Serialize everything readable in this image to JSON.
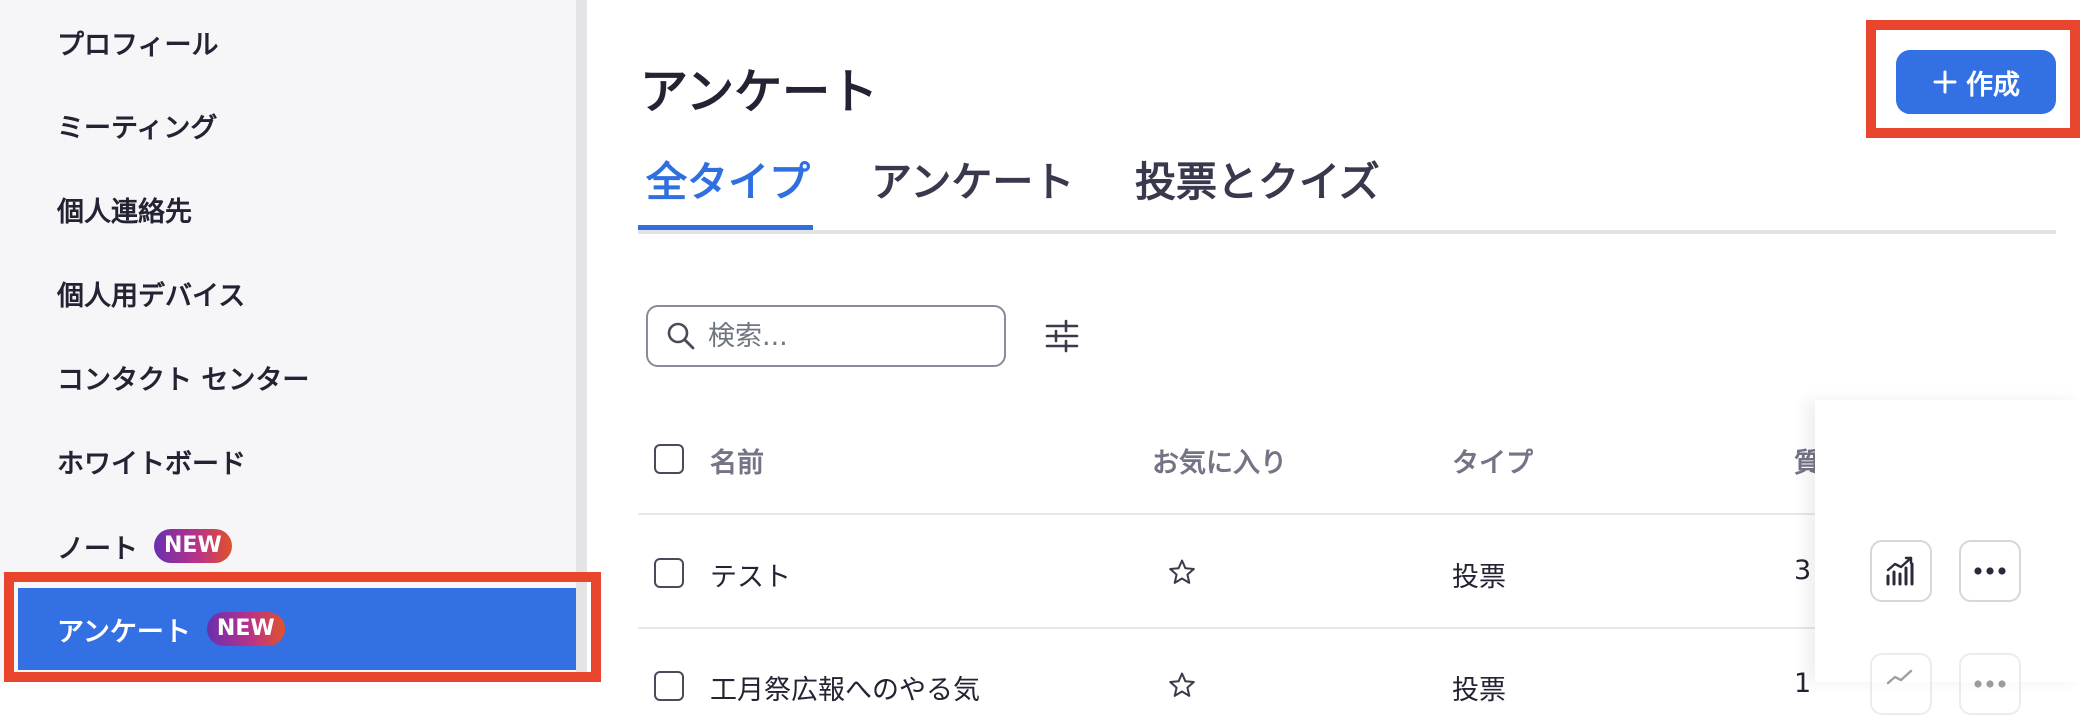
{
  "sidebar": {
    "items": [
      {
        "label": "プロフィール"
      },
      {
        "label": "ミーティング"
      },
      {
        "label": "個人連絡先"
      },
      {
        "label": "個人用デバイス"
      },
      {
        "label": "コンタクト センター"
      },
      {
        "label": "ホワイトボード"
      },
      {
        "label": "ノート",
        "badge": "NEW"
      },
      {
        "label": "アンケート",
        "badge": "NEW",
        "active": true
      }
    ]
  },
  "main": {
    "title": "アンケート",
    "create_button": "作成",
    "tabs": [
      {
        "label": "全タイプ",
        "active": true
      },
      {
        "label": "アンケート"
      },
      {
        "label": "投票とクイズ"
      }
    ],
    "search": {
      "placeholder": "検索..."
    },
    "table": {
      "columns": [
        "名前",
        "お気に入り",
        "タイプ",
        "質"
      ],
      "rows": [
        {
          "name": "テスト",
          "type": "投票",
          "questions": "3"
        },
        {
          "name": "工月祭広報へのやる気",
          "type": "投票",
          "questions": "1"
        }
      ]
    }
  },
  "colors": {
    "accent": "#3270e4",
    "highlight": "#e8452c",
    "tab_active": "#2f6fe0"
  }
}
